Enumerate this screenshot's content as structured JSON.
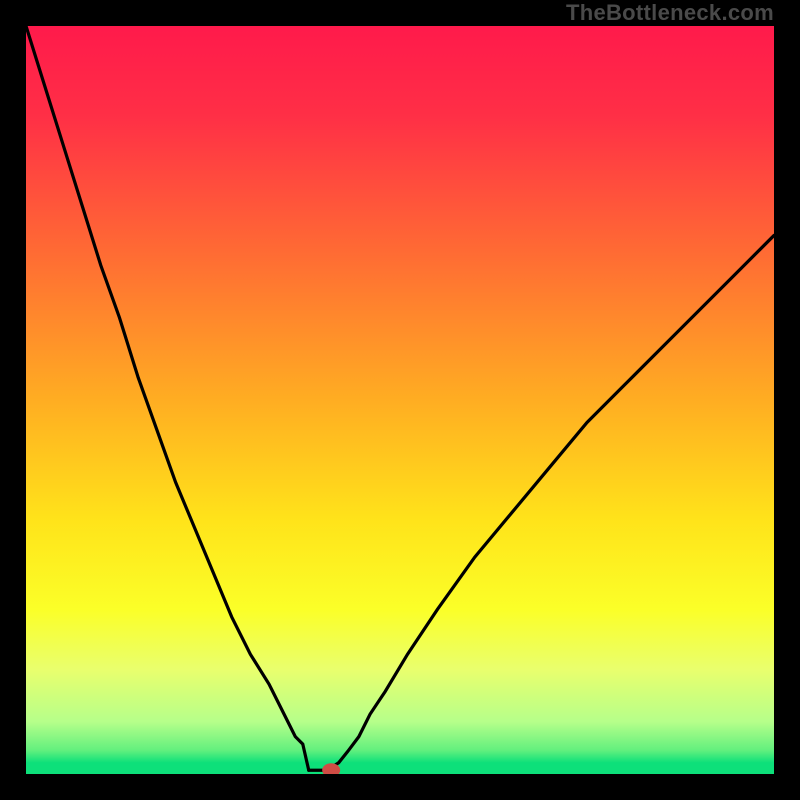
{
  "watermark": "TheBottleneck.com",
  "colors": {
    "frame_border": "#000000",
    "curve": "#000000",
    "marker": "#cf4d45",
    "gradient_stops": [
      {
        "offset": 0.0,
        "color": "#ff1a4b"
      },
      {
        "offset": 0.12,
        "color": "#ff2f46"
      },
      {
        "offset": 0.3,
        "color": "#ff6a34"
      },
      {
        "offset": 0.5,
        "color": "#ffad22"
      },
      {
        "offset": 0.66,
        "color": "#ffe31a"
      },
      {
        "offset": 0.78,
        "color": "#fbff28"
      },
      {
        "offset": 0.86,
        "color": "#e9ff6d"
      },
      {
        "offset": 0.93,
        "color": "#b6ff8a"
      },
      {
        "offset": 0.968,
        "color": "#63f07e"
      },
      {
        "offset": 0.985,
        "color": "#0de07a"
      },
      {
        "offset": 1.0,
        "color": "#0de07a"
      }
    ]
  },
  "chart_data": {
    "type": "line",
    "title": "",
    "xlabel": "",
    "ylabel": "",
    "xlim": [
      0,
      1
    ],
    "ylim": [
      0,
      1
    ],
    "x": [
      0.0,
      0.025,
      0.05,
      0.075,
      0.1,
      0.125,
      0.15,
      0.175,
      0.2,
      0.225,
      0.25,
      0.275,
      0.3,
      0.325,
      0.35,
      0.36,
      0.37,
      0.38,
      0.39,
      0.395,
      0.4,
      0.405,
      0.41,
      0.418,
      0.43,
      0.445,
      0.46,
      0.48,
      0.51,
      0.55,
      0.6,
      0.65,
      0.7,
      0.75,
      0.8,
      0.85,
      0.9,
      0.95,
      1.0
    ],
    "values": [
      1.0,
      0.92,
      0.84,
      0.76,
      0.68,
      0.61,
      0.53,
      0.46,
      0.39,
      0.33,
      0.27,
      0.21,
      0.16,
      0.12,
      0.07,
      0.05,
      0.04,
      0.03,
      0.02,
      0.01,
      0.005,
      0.005,
      0.01,
      0.015,
      0.03,
      0.05,
      0.08,
      0.11,
      0.16,
      0.22,
      0.29,
      0.35,
      0.41,
      0.47,
      0.52,
      0.57,
      0.62,
      0.67,
      0.72
    ],
    "flat_segment": {
      "x0": 0.378,
      "x1": 0.408,
      "y": 0.005
    },
    "marker": {
      "x": 0.408,
      "y": 0.005
    },
    "annotations": []
  }
}
